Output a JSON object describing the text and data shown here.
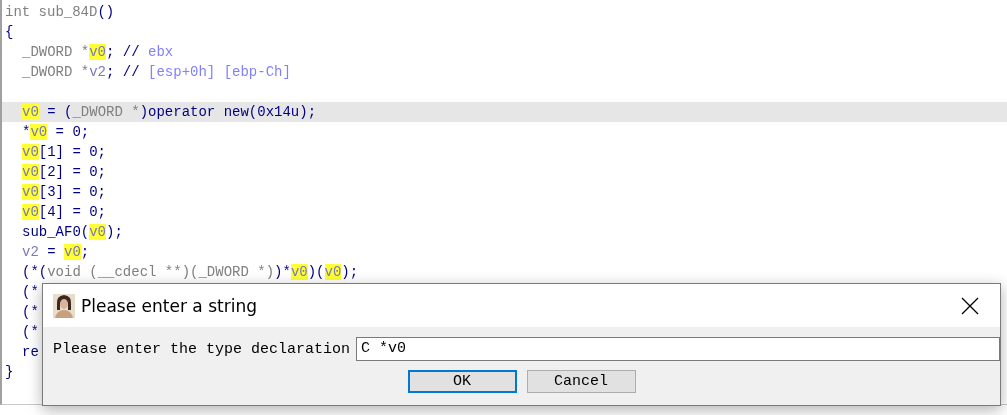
{
  "code_view": {
    "lines": [
      {
        "selected": false,
        "tokens": [
          {
            "kind": "type",
            "text": "int sub_84D"
          },
          {
            "kind": "code",
            "text": "()"
          }
        ]
      },
      {
        "selected": false,
        "tokens": [
          {
            "kind": "code",
            "text": "{"
          }
        ],
        "children": [
          {
            "selected": false,
            "tokens": [
              {
                "kind": "type",
                "text": "_DWORD *"
              },
              {
                "kind": "var",
                "text": "v0",
                "highlighted": true
              },
              {
                "kind": "code",
                "text": "; //"
              },
              {
                "kind": "comment",
                "text": " ebx"
              }
            ]
          },
          {
            "selected": false,
            "tokens": [
              {
                "kind": "type",
                "text": "_DWORD *"
              },
              {
                "kind": "var",
                "text": "v2",
                "highlighted": false
              },
              {
                "kind": "code",
                "text": "; //"
              },
              {
                "kind": "comment",
                "text": " [esp+0h] [ebp-Ch]"
              }
            ]
          },
          {
            "selected": false
          },
          {
            "selected": true,
            "tokens": [
              {
                "kind": "var",
                "text": "v0",
                "highlighted": true
              },
              {
                "kind": "code",
                "text": " = ("
              },
              {
                "kind": "type",
                "text": "_DWORD *"
              },
              {
                "kind": "code",
                "text": ")operator new(0x14u);"
              }
            ]
          },
          {
            "selected": false,
            "tokens": [
              {
                "kind": "code",
                "text": "*"
              },
              {
                "kind": "var",
                "text": "v0",
                "highlighted": true
              },
              {
                "kind": "code",
                "text": " = 0;"
              }
            ]
          },
          {
            "selected": false,
            "tokens": [
              {
                "kind": "var",
                "text": "v0",
                "highlighted": true
              },
              {
                "kind": "code",
                "text": "[1] = 0;"
              }
            ]
          },
          {
            "selected": false,
            "tokens": [
              {
                "kind": "var",
                "text": "v0",
                "highlighted": true
              },
              {
                "kind": "code",
                "text": "[2] = 0;"
              }
            ]
          },
          {
            "selected": false,
            "tokens": [
              {
                "kind": "var",
                "text": "v0",
                "highlighted": true
              },
              {
                "kind": "code",
                "text": "[3] = 0;"
              }
            ]
          },
          {
            "selected": false,
            "tokens": [
              {
                "kind": "var",
                "text": "v0",
                "highlighted": true
              },
              {
                "kind": "code",
                "text": "[4] = 0;"
              }
            ]
          },
          {
            "selected": false,
            "tokens": [
              {
                "kind": "code",
                "text": "sub_AF0("
              },
              {
                "kind": "var",
                "text": "v0",
                "highlighted": true
              },
              {
                "kind": "code",
                "text": ");"
              }
            ]
          },
          {
            "selected": false,
            "tokens": [
              {
                "kind": "var",
                "text": "v2",
                "highlighted": false
              },
              {
                "kind": "code",
                "text": " = "
              },
              {
                "kind": "var",
                "text": "v0",
                "highlighted": true
              },
              {
                "kind": "code",
                "text": ";"
              }
            ]
          },
          {
            "selected": false,
            "tokens": [
              {
                "kind": "code",
                "text": "(*("
              },
              {
                "kind": "type",
                "text": "void (__cdecl **)(_DWORD *)"
              },
              {
                "kind": "code",
                "text": ")*"
              },
              {
                "kind": "var",
                "text": "v0",
                "highlighted": true
              },
              {
                "kind": "code",
                "text": ")("
              },
              {
                "kind": "var",
                "text": "v0",
                "highlighted": true
              },
              {
                "kind": "code",
                "text": ");"
              }
            ]
          },
          {
            "selected": false,
            "tokens": [
              {
                "kind": "code",
                "text": "(*"
              }
            ]
          },
          {
            "selected": false,
            "tokens": [
              {
                "kind": "code",
                "text": "(*"
              }
            ]
          },
          {
            "selected": false,
            "tokens": [
              {
                "kind": "code",
                "text": "(*"
              }
            ]
          },
          {
            "selected": false,
            "tokens": [
              {
                "kind": "code",
                "text": "re"
              }
            ]
          }
        ]
      },
      {
        "selected": false,
        "tokens": [
          {
            "kind": "code",
            "text": "}"
          }
        ]
      }
    ]
  },
  "dialog": {
    "title": "Please enter a string",
    "label": "Please enter the type declaration",
    "value": "C *v0",
    "buttons": [
      {
        "label": "OK",
        "default": true
      },
      {
        "label": "Cancel",
        "default": false
      }
    ]
  }
}
